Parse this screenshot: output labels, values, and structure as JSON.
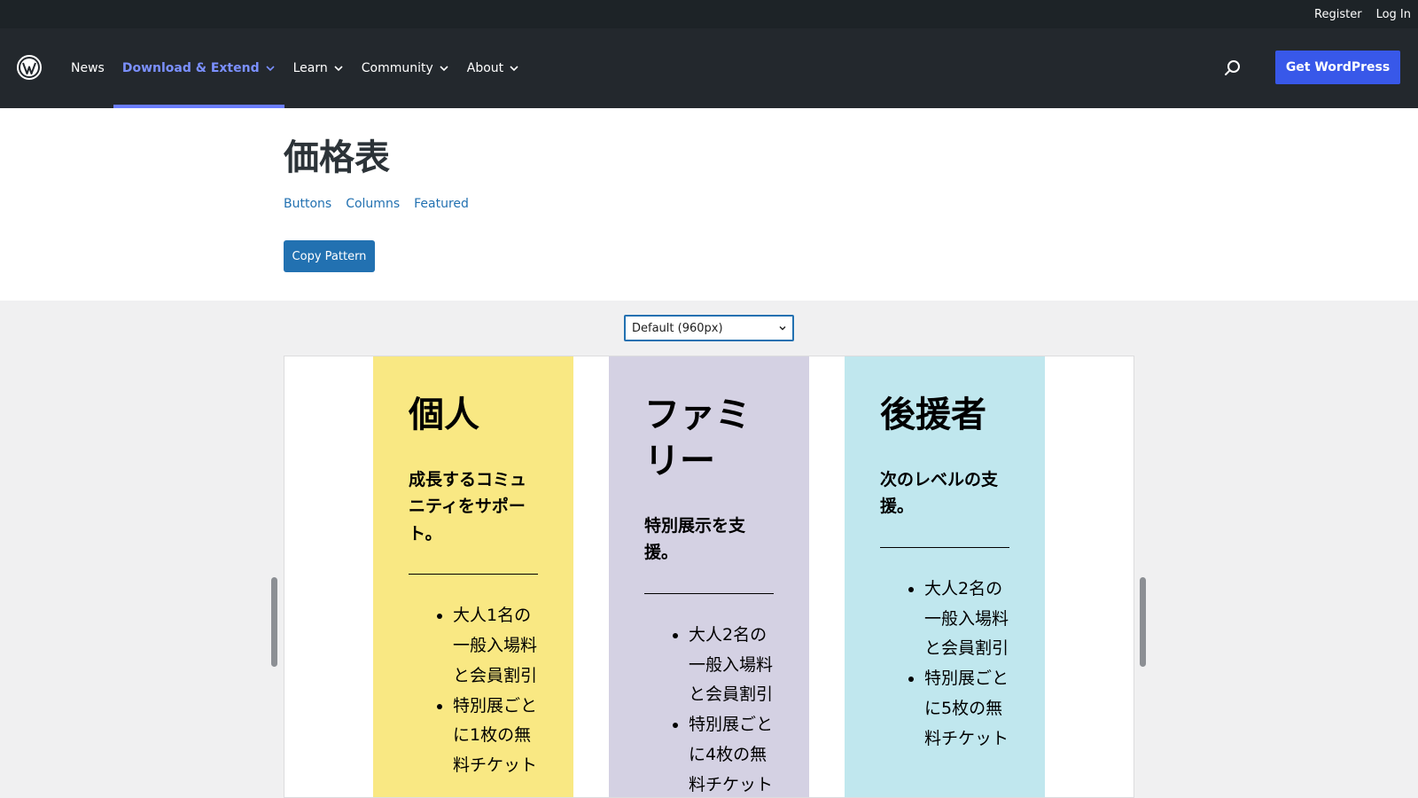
{
  "topbar": {
    "register": "Register",
    "login": "Log In"
  },
  "nav": {
    "items": [
      {
        "label": "News",
        "dropdown": false,
        "active": false
      },
      {
        "label": "Download & Extend",
        "dropdown": true,
        "active": true
      },
      {
        "label": "Learn",
        "dropdown": true,
        "active": false
      },
      {
        "label": "Community",
        "dropdown": true,
        "active": false
      },
      {
        "label": "About",
        "dropdown": true,
        "active": false
      }
    ],
    "cta": "Get WordPress"
  },
  "pattern": {
    "title": "価格表",
    "categories": [
      "Buttons",
      "Columns",
      "Featured"
    ],
    "copy_button": "Copy Pattern"
  },
  "preview": {
    "width_select": "Default (960px)",
    "columns": [
      {
        "title": "個人",
        "description": "成長するコミュニティをサポート。",
        "features": [
          "大人1名の一般入場料と会員割引",
          "特別展ごとに1枚の無料チケット"
        ],
        "bg": "#f9e883"
      },
      {
        "title": "ファミリー",
        "description": "特別展示を支援。",
        "features": [
          "大人2名の一般入場料と会員割引",
          "特別展ごとに4枚の無料チケット"
        ],
        "bg": "#d4d1e3"
      },
      {
        "title": "後援者",
        "description": "次のレベルの支援。",
        "features": [
          "大人2名の一般入場料と会員割引",
          "特別展ごとに5枚の無料チケット"
        ],
        "bg": "#c0e7ee"
      }
    ]
  },
  "colors": {
    "accent": "#3858e9",
    "link": "#2271b1",
    "nav_bg": "#23282d",
    "topbar_bg": "#1d2327"
  }
}
